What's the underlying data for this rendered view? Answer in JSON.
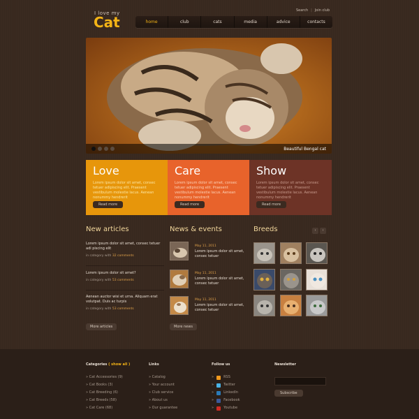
{
  "header": {
    "logo_small": "I love my",
    "logo_big": "Cat",
    "top_links": [
      "Search",
      "Join club"
    ],
    "nav": [
      "home",
      "club",
      "cats",
      "media",
      "advice",
      "contacts"
    ]
  },
  "hero": {
    "caption": "Beautiful Bengal cat",
    "slides": 4,
    "active_slide": 1
  },
  "features": [
    {
      "title": "Love",
      "text": "Lorem ipsum dolor sit amet, consec tetuer adipiscing elit. Praesent vestibulum molestie lacus. Aenean nonummy hendrerit",
      "button": "Read more"
    },
    {
      "title": "Care",
      "text": "Lorem ipsum dolor sit amet, consec tetuer adipiscing elit. Praesent vestibulum molestie lacus. Aenean nonummy hendrerit",
      "button": "Read more"
    },
    {
      "title": "Show",
      "text": "Lorem ipsum dolor sit amet, consec tetuer adipiscing elit. Praesent vestibulum molestie lacus. Aenean nonummy hendrerit",
      "button": "Read more"
    }
  ],
  "sections": {
    "articles_title": "New articles",
    "news_title": "News & events",
    "breeds_title": "Breeds"
  },
  "articles": [
    {
      "text": "Lorem ipsum dolor sit amet, consec tetuer adi piscing elit",
      "meta_prefix": "in category with",
      "comments": "32 comments"
    },
    {
      "text": "Lorem ipsum dolor sit amet?",
      "meta_prefix": "in category with",
      "comments": "53 comments"
    },
    {
      "text": "Aenean auctor wisi et urna. Aliquam erat volutpat. Duis ac turpis",
      "meta_prefix": "in category with",
      "comments": "53 comments"
    }
  ],
  "more_articles": "More articles",
  "news": [
    {
      "date": "May 11, 2011",
      "text": "Lorem ipsum dolor sit amet, consec tetuer"
    },
    {
      "date": "May 11, 2011",
      "text": "Lorem ipsum dolor sit amet, consec tetuer"
    },
    {
      "date": "May 11, 2011",
      "text": "Lorem ipsum dolor sit amet, consec tetuer"
    }
  ],
  "more_news": "More news",
  "breed_nav": [
    "‹",
    "›"
  ],
  "footer": {
    "categories_title": "Categories",
    "categories_show": "( show all )",
    "categories": [
      "Cat Accessories (9)",
      "Cat Books (3)",
      "Cat Breeding (6)",
      "Cat Breeds (58)",
      "Cat Care (68)"
    ],
    "links_title": "Links",
    "links": [
      "Catalog",
      "Your account",
      "Club service",
      "About us",
      "Our guarantee"
    ],
    "follow_title": "Follow us",
    "follow": [
      {
        "label": "RSS",
        "color": "#f39a1e"
      },
      {
        "label": "Twitter",
        "color": "#4ab3e6"
      },
      {
        "label": "LinkedIn",
        "color": "#2a7ab8"
      },
      {
        "label": "Facebook",
        "color": "#3b5a9a"
      },
      {
        "label": "Youtube",
        "color": "#cf2b23"
      }
    ],
    "newsletter_title": "Newsletter",
    "subscribe": "Subscribe"
  }
}
